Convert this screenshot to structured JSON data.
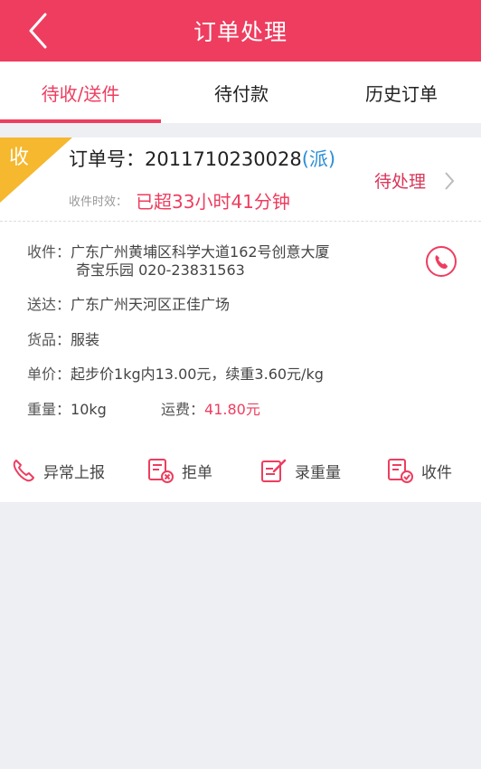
{
  "header": {
    "title": "订单处理",
    "back_icon": "chevron-left-icon"
  },
  "tabs": [
    {
      "label": "待收/送件",
      "active": true
    },
    {
      "label": "待付款",
      "active": false
    },
    {
      "label": "历史订单",
      "active": false
    }
  ],
  "order": {
    "badge": "收",
    "number_label": "订单号：",
    "number": "2011710230028",
    "tag": "(派)",
    "time_label": "收件时效：",
    "time_value": "已超33小时41分钟",
    "status": "待处理",
    "pickup": {
      "label": "收件：",
      "line1": "广东广州黄埔区科学大道162号创意大厦",
      "line2": "奇宝乐园 020-23831563"
    },
    "delivery": {
      "label": "送达：",
      "value": "广东广州天河区正佳广场"
    },
    "goods": {
      "label": "货品：",
      "value": "服装"
    },
    "price": {
      "label": "单价：",
      "value": "起步价1kg内13.00元，续重3.60元/kg"
    },
    "weight": {
      "label": "重量：",
      "value": "10kg"
    },
    "freight": {
      "label": "运费：",
      "value": "41.80元"
    }
  },
  "actions": [
    {
      "label": "异常上报",
      "icon": "phone-icon"
    },
    {
      "label": "拒单",
      "icon": "reject-doc-icon"
    },
    {
      "label": "录重量",
      "icon": "edit-weight-icon"
    },
    {
      "label": "收件",
      "icon": "receive-doc-icon"
    }
  ],
  "colors": {
    "brand": "#ee3d5f",
    "corner": "#f5b82e",
    "tag": "#2b8fd6",
    "background": "#eeeff3"
  }
}
